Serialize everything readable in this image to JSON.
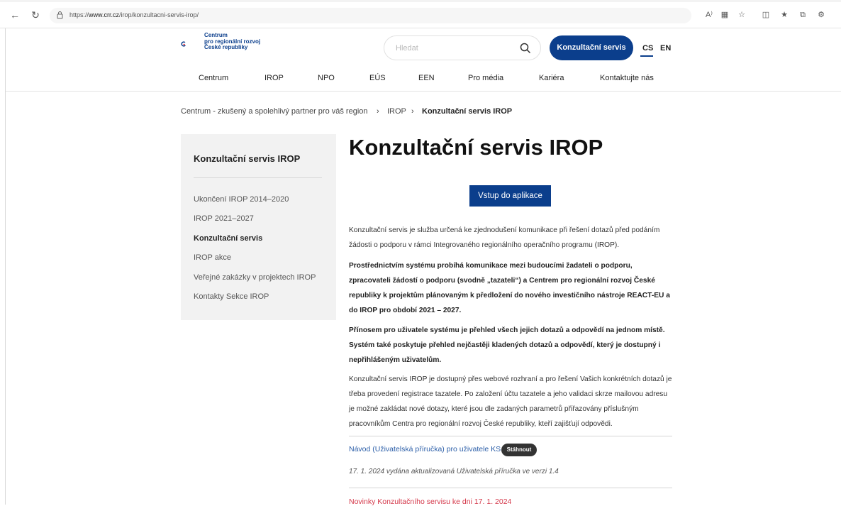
{
  "browser": {
    "url_prefix": "https://",
    "url_domain": "www.crr.cz",
    "url_path": "/irop/konzultacni-servis-irop/"
  },
  "header": {
    "logo_lines": [
      "Centrum",
      "pro regionální rozvoj",
      "České republiky"
    ],
    "search_placeholder": "Hledat",
    "ks_button": "Konzultační servis",
    "lang_cs": "CS",
    "lang_en": "EN",
    "menu": [
      "Centrum",
      "IROP",
      "NPO",
      "EÚS",
      "EEN",
      "Pro média",
      "Kariéra",
      "Kontaktujte nás"
    ]
  },
  "breadcrumb": {
    "items": [
      "Centrum - zkušený a spolehlivý partner pro váš region",
      "IROP",
      "Konzultační servis IROP"
    ],
    "separator": "›"
  },
  "sidebar": {
    "title": "Konzultační servis IROP",
    "items": [
      "Ukončení IROP 2014–2020",
      "IROP 2021–2027",
      "Konzultační servis",
      "IROP akce",
      "Veřejné zakázky v projektech IROP",
      "Kontakty Sekce IROP"
    ],
    "active_index": 2
  },
  "main": {
    "title": "Konzultační servis IROP",
    "app_button": "Vstup do aplikace",
    "p1": "Konzultační servis je služba určená ke zjednodušení komunikace při řešení dotazů před podáním žádosti o podporu v rámci Integrovaného regionálního operačního programu (IROP).",
    "p2": "Prostřednictvím systému probíhá komunikace mezi budoucími žadateli o podporu, zpracovateli žádostí o podporu (svodně „tazateli“) a Centrem pro regionální rozvoj České republiky k projektům plánovaným k předložení do nového investičního nástroje REACT-EU a do IROP pro období 2021 – 2027.",
    "p3": "Přínosem pro uživatele systému je přehled všech jejich dotazů a odpovědí na jednom místě. Systém také poskytuje přehled nejčastěji kladených dotazů a odpovědí, který je dostupný i nepřihlášeným uživatelům.",
    "p4": "Konzultační servis IROP je dostupný přes webové rozhraní a pro řešení Vašich konkrétních dotazů je třeba provedení registrace tazatele. Po založení účtu tazatele a jeho validaci skrze mailovou adresu je možné zakládat nové dotazy, které jsou dle zadaných parametrů přiřazovány příslušným pracovníkům Centra pro regionální rozvoj České republiky, kteří zajišťují odpovědi.",
    "manual_link": "Návod (Uživatelská příručka) pro uživatele KS",
    "download_badge": "Stáhnout",
    "manual_note": "17. 1. 2024 vydána aktualizovaná Uživatelská příručka ve verzi 1.4",
    "news_link": "Novinky Konzultačního servisu ke dni 17. 1. 2024"
  },
  "colors": {
    "brand_blue": "#0b3e8c",
    "logo_red": "#e30613",
    "link_blue": "#2b5ea8",
    "news_red": "#d4384a"
  }
}
